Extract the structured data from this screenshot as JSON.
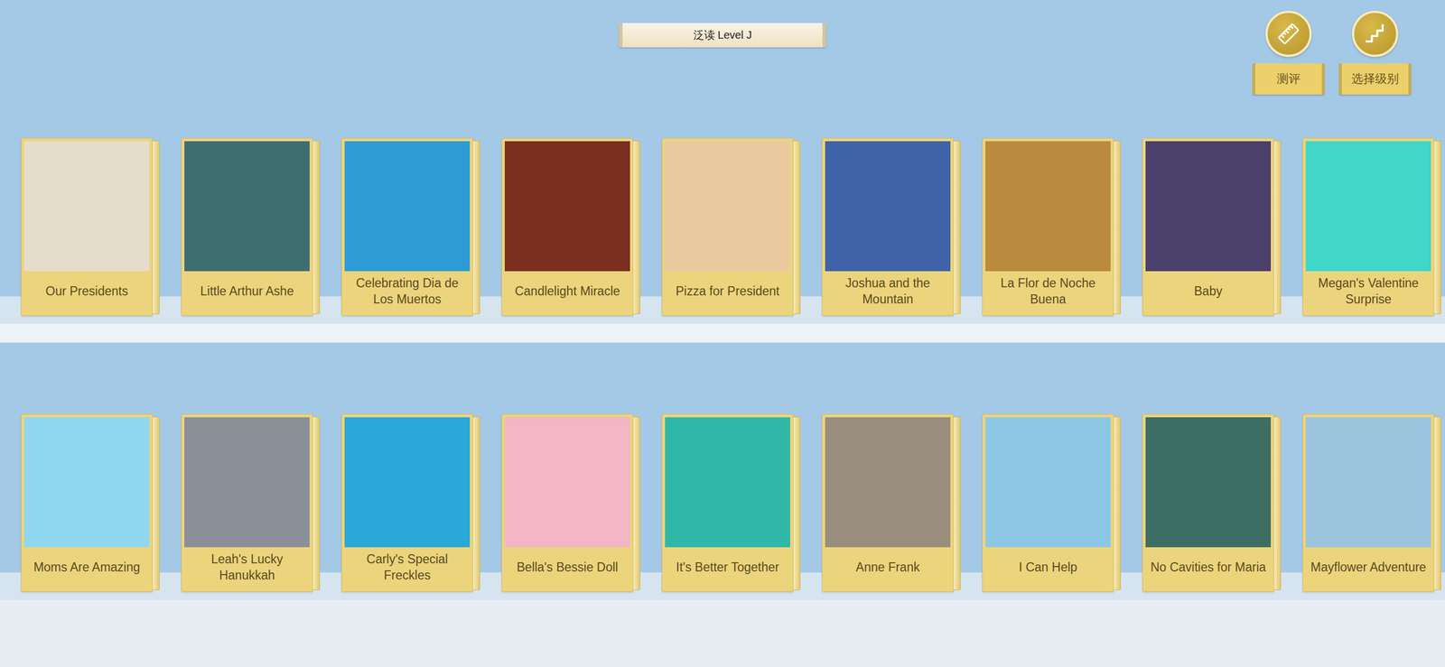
{
  "window": {
    "title": "泛读 Level J"
  },
  "toolbar": {
    "buttons": [
      {
        "label": "测评"
      },
      {
        "label": "选择级别"
      }
    ]
  },
  "shelves": [
    {
      "books": [
        {
          "title": "Our Presidents",
          "color": "#e6dccb"
        },
        {
          "title": "Little Arthur Ashe",
          "color": "#3f6e70"
        },
        {
          "title": "Celebrating Dia de Los Muertos",
          "color": "#2f9bd6"
        },
        {
          "title": "Candlelight Miracle",
          "color": "#7a2f1f"
        },
        {
          "title": "Pizza for President",
          "color": "#ebc9a0"
        },
        {
          "title": "Joshua and the Mountain",
          "color": "#4062a8"
        },
        {
          "title": "La Flor de Noche Buena",
          "color": "#b98b3e"
        },
        {
          "title": "Baby",
          "color": "#4b3f6b"
        },
        {
          "title": "Megan's Valentine Surprise",
          "color": "#40d6c8"
        }
      ]
    },
    {
      "books": [
        {
          "title": "Moms Are Amazing",
          "color": "#8fd8f0"
        },
        {
          "title": "Leah's Lucky Hanukkah",
          "color": "#8a8f9a"
        },
        {
          "title": "Carly's Special Freckles",
          "color": "#2aa8d8"
        },
        {
          "title": "Bella's Bessie Doll",
          "color": "#f2b6c4"
        },
        {
          "title": "It's Better Together",
          "color": "#2fb8a8"
        },
        {
          "title": "Anne Frank",
          "color": "#9a8e7e"
        },
        {
          "title": "I Can Help",
          "color": "#8cc8e6"
        },
        {
          "title": "No Cavities for Maria",
          "color": "#3c6e63"
        },
        {
          "title": "Mayflower Adventure",
          "color": "#9cc4de"
        }
      ]
    }
  ]
}
